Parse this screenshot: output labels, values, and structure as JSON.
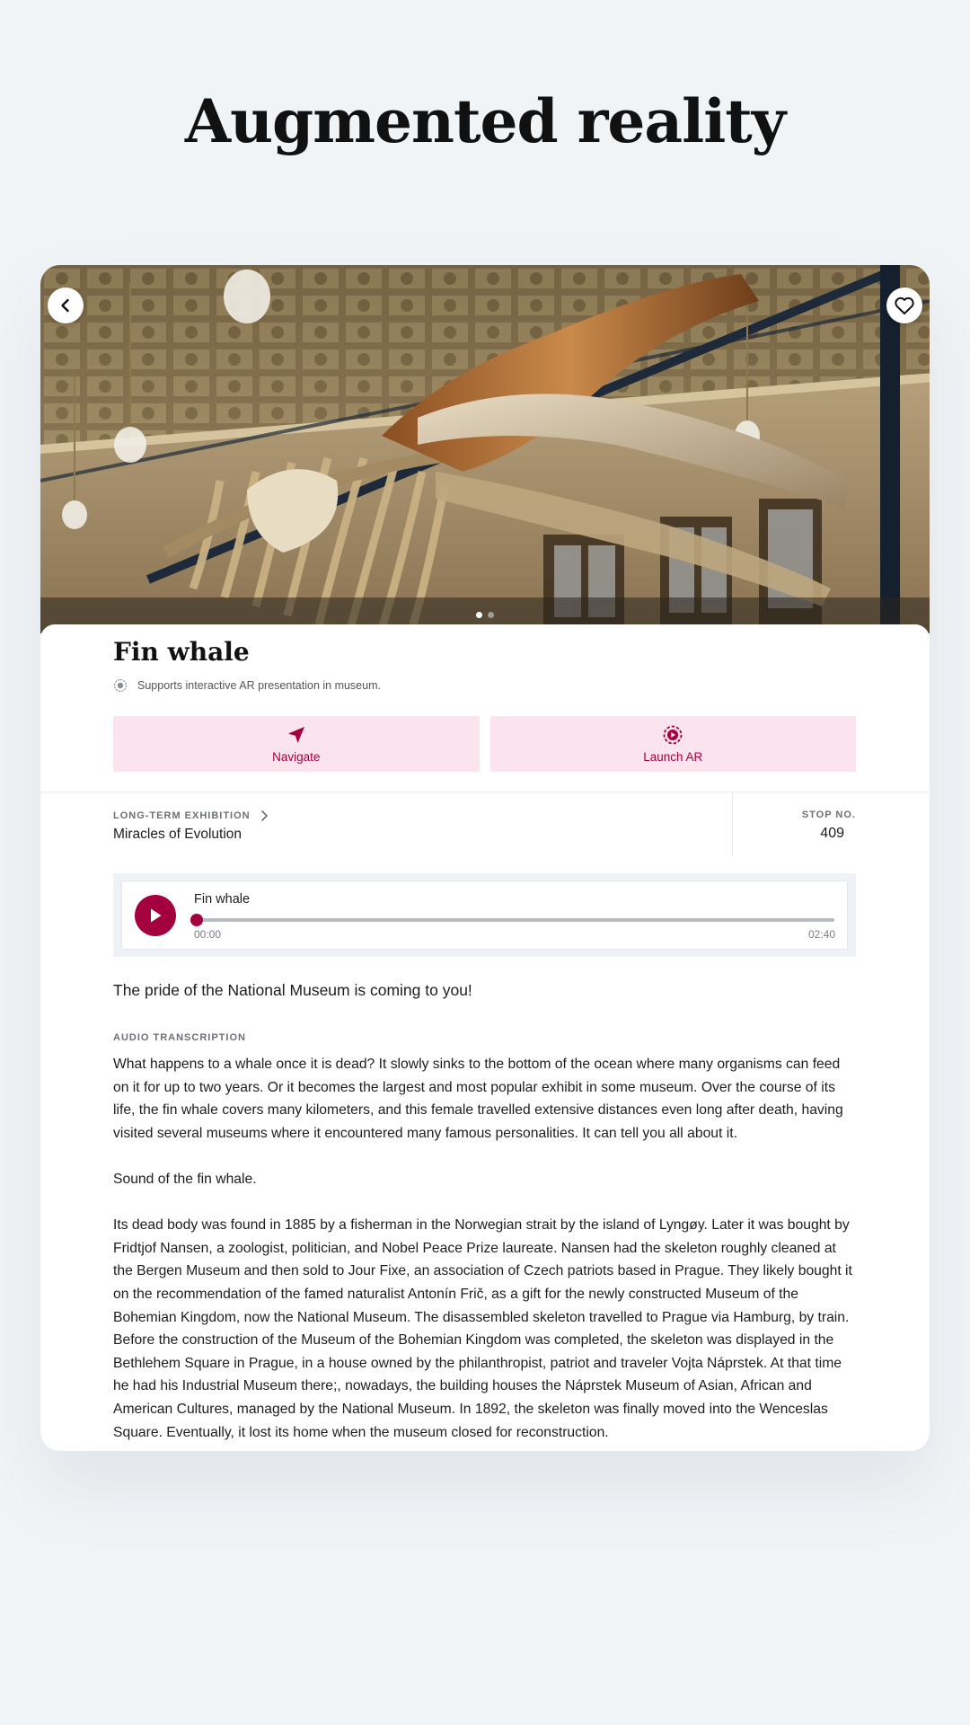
{
  "page": {
    "title": "Augmented reality"
  },
  "exhibit": {
    "title": "Fin whale",
    "ar_note": "Supports interactive AR presentation in museum.",
    "actions": {
      "navigate": "Navigate",
      "launch_ar": "Launch AR"
    },
    "exhibition": {
      "caption": "LONG-TERM EXHIBITION",
      "name": "Miracles of Evolution"
    },
    "stop": {
      "caption": "STOP NO.",
      "number": "409"
    }
  },
  "audio": {
    "title": "Fin whale",
    "current_time": "00:00",
    "total_time": "02:40",
    "progress": 0
  },
  "content": {
    "tagline": "The pride of the National Museum is coming to you!",
    "transcript_caption": "AUDIO TRANSCRIPTION",
    "paragraphs": [
      "What happens to a whale once it is dead? It slowly sinks to the bottom of the ocean where many organisms can feed on it for up to two years. Or it becomes the largest and most popular exhibit in some museum. Over the course of its life, the fin whale covers many kilometers, and this female travelled extensive distances even long after death, having visited several museums where it encountered many famous personalities. It can tell you all about it.",
      "Sound of the fin whale.",
      "Its dead body was found in 1885 by a fisherman in the Norwegian strait by the island of Lyngøy. Later it was bought by Fridtjof Nansen, a zoologist, politician, and Nobel Peace Prize laureate. Nansen had the skeleton roughly cleaned at the Bergen Museum and then sold to Jour Fixe, an association of Czech patriots based in Prague. They likely bought it on the recommendation of the famed naturalist Antonín Frič, as a gift for the newly constructed Museum of the Bohemian Kingdom, now the National Museum. The disassembled skeleton travelled to Prague via Hamburg, by train. Before the construction of the Museum of the Bohemian Kingdom was completed, the skeleton was displayed in the Bethlehem Square in Prague, in a house owned by the philanthropist, patriot and traveler Vojta Náprstek. At that time he had his Industrial Museum there;, nowadays, the building houses the Náprstek Museum of Asian, African and American Cultures, managed by the National Museum. In 1892, the skeleton was finally moved into the Wenceslas Square. Eventually, it lost its home when the museum closed for reconstruction."
    ]
  },
  "colors": {
    "accent": "#a4003f",
    "accent_soft": "#fbe4ee",
    "background": "#f1f4f7"
  }
}
